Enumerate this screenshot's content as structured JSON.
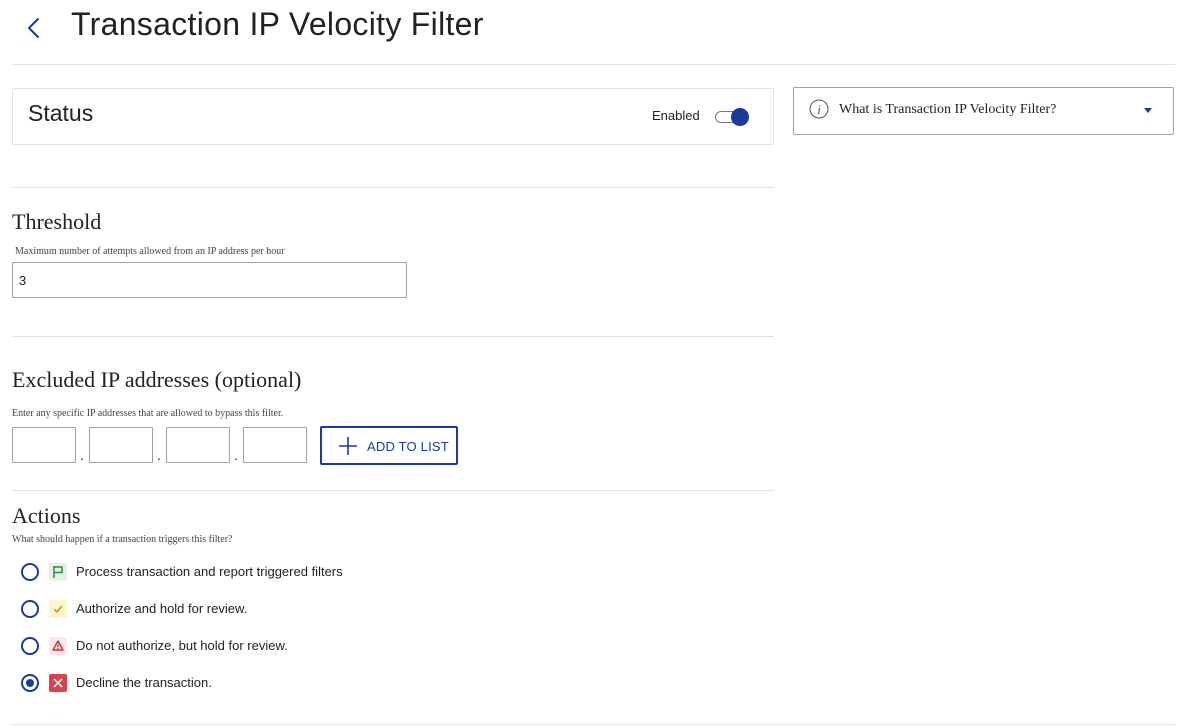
{
  "header": {
    "title": "Transaction IP Velocity Filter",
    "back_icon": "chevron-left-icon"
  },
  "status": {
    "title": "Status",
    "toggle_label": "Enabled",
    "enabled": true,
    "accent_color": "#1a3a9e"
  },
  "info_panel": {
    "text": "What is Transaction IP Velocity Filter?",
    "icon": "info-icon",
    "caret_icon": "caret-down-icon"
  },
  "threshold": {
    "title": "Threshold",
    "helper": "Maximum number of attempts allowed from an IP address per hour",
    "value": "3"
  },
  "excluded_ips": {
    "title": "Excluded IP addresses (optional)",
    "helper": "Enter any specific IP addresses that are allowed to bypass this filter.",
    "octets": [
      "",
      "",
      "",
      ""
    ],
    "separator": ".",
    "add_button_label": "ADD TO LIST"
  },
  "actions": {
    "title": "Actions",
    "helper": "What should happen if a transaction triggers this filter?",
    "options": [
      {
        "label": "Process transaction and report triggered filters",
        "icon": "flag-icon",
        "selected": false,
        "color": "#2e8b3e"
      },
      {
        "label": "Authorize and hold for review.",
        "icon": "check-icon",
        "selected": false,
        "color": "#d9a400"
      },
      {
        "label": "Do not authorize, but hold for review.",
        "icon": "warning-icon",
        "selected": false,
        "color": "#d12c3a"
      },
      {
        "label": "Decline the transaction.",
        "icon": "close-icon",
        "selected": true,
        "color": "#d8434d"
      }
    ]
  }
}
